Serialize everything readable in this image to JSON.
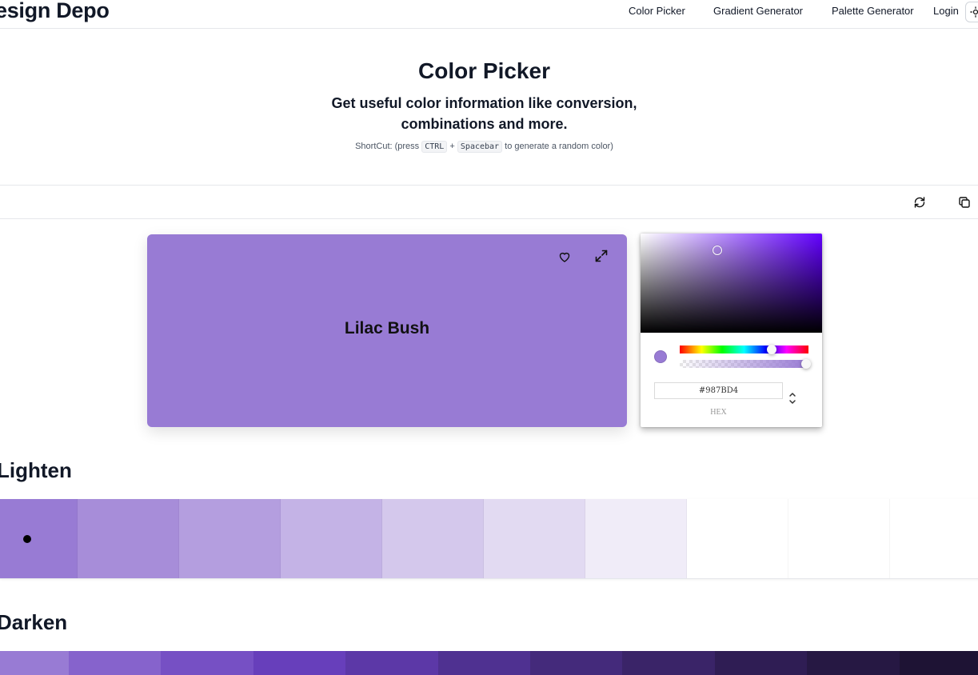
{
  "header": {
    "brand": "esign Depo",
    "nav": {
      "color_picker": "Color Picker",
      "gradient_generator": "Gradient Generator",
      "palette_generator": "Palette Generator",
      "login": "Login"
    },
    "theme_icon": "sun-icon"
  },
  "hero": {
    "title": "Color Picker",
    "subtitle_line1": "Get useful color information like conversion,",
    "subtitle_line2": "combinations and more.",
    "shortcut_prefix": "ShortCut: (press",
    "shortcut_key1": "CTRL",
    "shortcut_plus": "+",
    "shortcut_key2": "Spacebar",
    "shortcut_suffix": "to generate a random color)"
  },
  "toolbar": {
    "refresh_icon": "refresh-icon",
    "copy_icon": "copy-icon"
  },
  "preview": {
    "color_name": "Lilac Bush",
    "color": "#987BD4",
    "favorite_icon": "heart-icon",
    "fullscreen_icon": "expand-icon"
  },
  "picker": {
    "hex_value": "#987BD4",
    "format_label": "HEX",
    "hue_color": "#6200ff",
    "current_color": "#987BD4"
  },
  "lighten": {
    "title": "Lighten",
    "swatches": [
      "#987BD4",
      "#A78DD9",
      "#B49EDF",
      "#C4B3E6",
      "#D4C8EC",
      "#E2DAF2",
      "#F0ECF8",
      "#FFFFFF",
      "#FFFFFF",
      "#FFFFFF"
    ],
    "swatch_width": 127,
    "first_width": 97
  },
  "darken": {
    "title": "Darken",
    "swatches": [
      "#987BD4",
      "#8663CC",
      "#7650C4",
      "#673FBB",
      "#5C38A7",
      "#4F3191",
      "#442A7B",
      "#3A2468",
      "#2F1D54",
      "#261843",
      "#1E1334"
    ]
  }
}
